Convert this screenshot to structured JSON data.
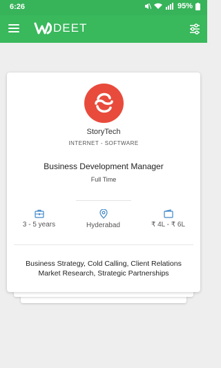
{
  "status_bar": {
    "time": "6:26",
    "battery": "95%",
    "icons": [
      "mute-icon",
      "wifi-icon",
      "signal-icon",
      "battery-icon"
    ]
  },
  "app_bar": {
    "brand": "DEET",
    "menu_icon": "hamburger-menu-icon",
    "filter_icon": "filter-sliders-icon"
  },
  "job": {
    "company": "StoryTech",
    "industry": "INTERNET - SOFTWARE",
    "title": "Business Development Manager",
    "type": "Full Time",
    "experience": "3 - 5 years",
    "location": "Hyderabad",
    "salary": "₹ 4L - ₹ 6L",
    "skills_line1": "Business Strategy, Cold Calling, Client Relations",
    "skills_line2": "Market Research, Strategic Partnerships"
  },
  "colors": {
    "primary": "#39b85c",
    "status_bar": "#37b35a",
    "logo_red": "#e84b3c",
    "icon_blue": "#3e86c8"
  }
}
